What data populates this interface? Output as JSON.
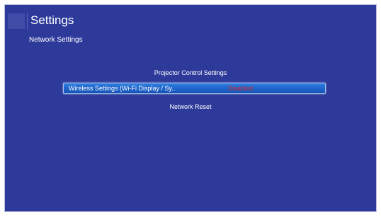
{
  "header": {
    "icon": "settings-icon",
    "title": "Settings",
    "breadcrumb": "Network Settings"
  },
  "menu": {
    "items": [
      {
        "label": "Projector Control Settings",
        "value": ""
      },
      {
        "label": "Wireless Settings (Wi-Fi Display / Sy..",
        "value": "Disabled",
        "selected": true
      },
      {
        "label": "Network Reset",
        "value": ""
      }
    ]
  },
  "colors": {
    "background": "#2e3a9a",
    "highlight": "#1e63c9",
    "disabled_value": "#d8262a",
    "text": "#ffffff"
  }
}
